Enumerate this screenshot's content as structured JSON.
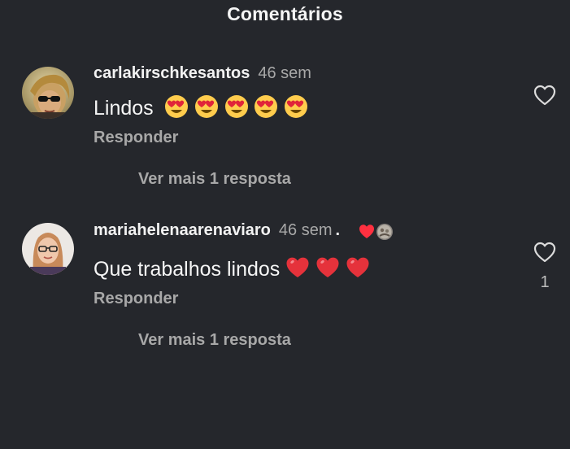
{
  "header": {
    "title": "Comentários"
  },
  "comments": [
    {
      "username": "carlakirschkesantos",
      "time": "46 sem",
      "text": "Lindos",
      "emojis": [
        "heart-eyes",
        "heart-eyes",
        "heart-eyes",
        "heart-eyes",
        "heart-eyes"
      ],
      "reply_label": "Responder",
      "more_replies_label": "Ver mais 1 resposta",
      "like_count": ""
    },
    {
      "username": "mariahelenaarenaviaro",
      "time": "46 sem",
      "dot": ".",
      "text": "Que trabalhos lindos",
      "emojis": [
        "red-heart",
        "red-heart",
        "red-heart"
      ],
      "reply_label": "Responder",
      "more_replies_label": "Ver mais 1 resposta",
      "like_count": "1"
    }
  ],
  "colors": {
    "background": "#25272c",
    "text_primary": "#f5f5f5",
    "text_secondary": "#a8a8a8",
    "heart_red": "#ff3040"
  }
}
